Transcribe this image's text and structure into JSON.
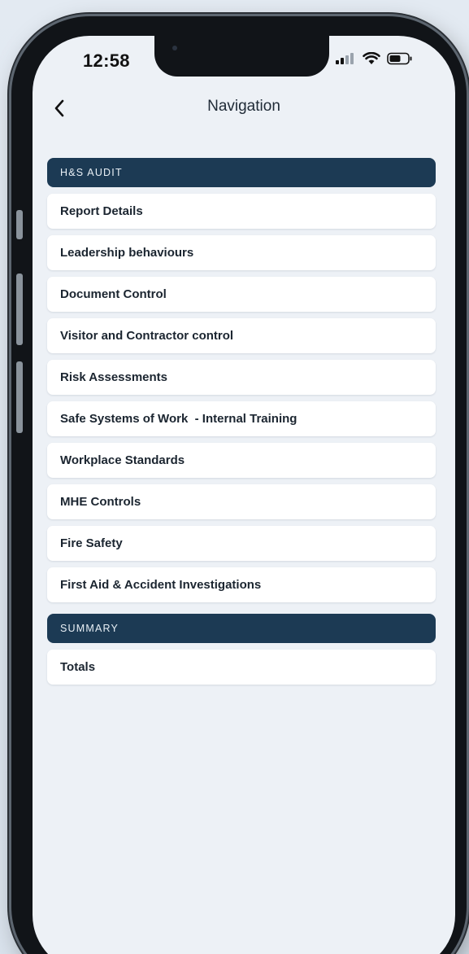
{
  "status_bar": {
    "time": "12:58"
  },
  "header": {
    "title": "Navigation"
  },
  "sections": [
    {
      "label": "H&S AUDIT",
      "items": [
        {
          "label": "Report Details"
        },
        {
          "label": "Leadership behaviours"
        },
        {
          "label": "Document Control"
        },
        {
          "label": "Visitor and Contractor control"
        },
        {
          "label": "Risk Assessments"
        },
        {
          "label": "Safe Systems of Work  - Internal Training"
        },
        {
          "label": "Workplace Standards"
        },
        {
          "label": "MHE Controls"
        },
        {
          "label": "Fire Safety"
        },
        {
          "label": "First Aid & Accident Investigations"
        }
      ]
    },
    {
      "label": "SUMMARY",
      "items": [
        {
          "label": "Totals"
        }
      ]
    }
  ],
  "colors": {
    "section_header_bg": "#1c3a54",
    "screen_bg": "#edf1f6",
    "item_bg": "#ffffff"
  }
}
